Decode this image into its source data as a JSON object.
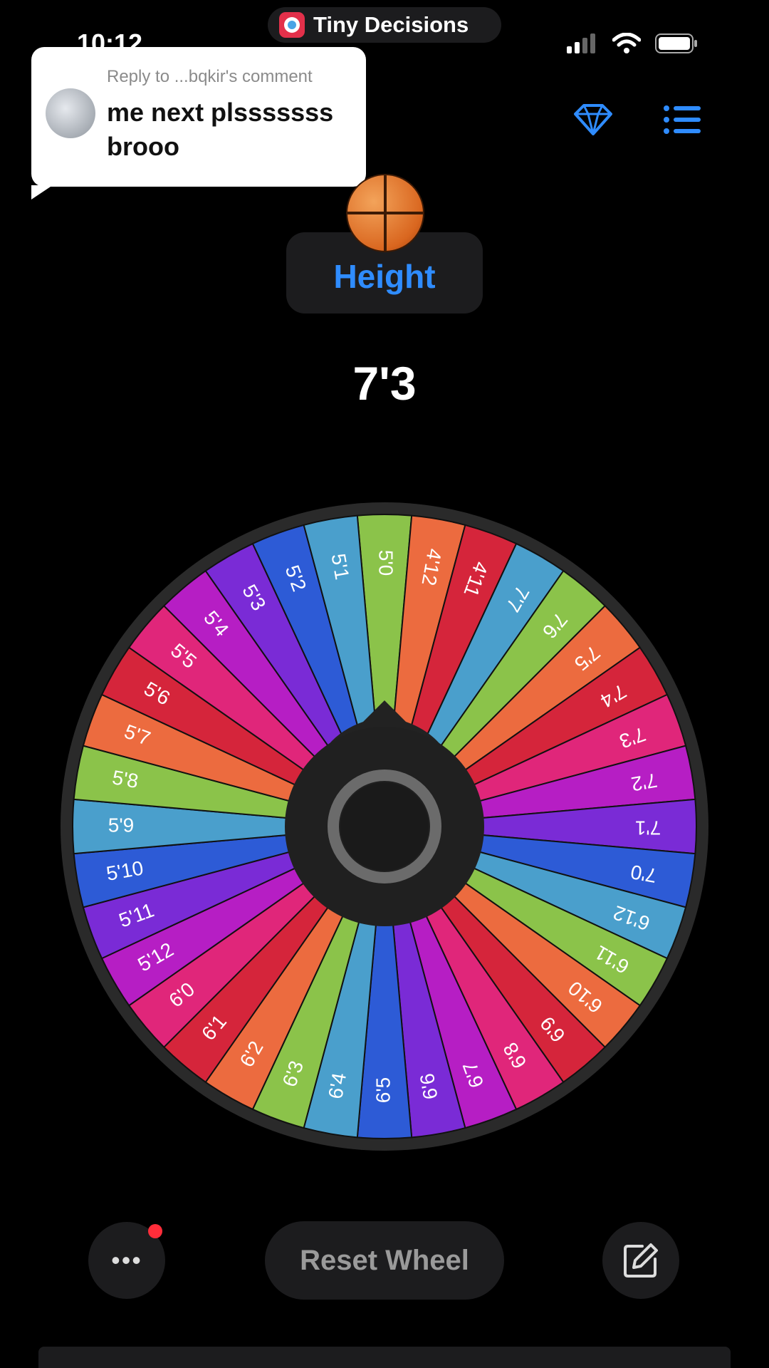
{
  "status_bar": {
    "time": "10:12"
  },
  "overlay_app": {
    "name": "Tiny Decisions"
  },
  "reply": {
    "header": "Reply to ...bqkir's comment",
    "text": "me next plsssssss brooo"
  },
  "wheel_title": {
    "emoji": "basketball",
    "label": "Height"
  },
  "result": "7'3",
  "wheel": {
    "segments": [
      {
        "label": "5'0",
        "color": "#8bc34a"
      },
      {
        "label": "4'12",
        "color": "#ec6b3f"
      },
      {
        "label": "4'11",
        "color": "#d5253b"
      },
      {
        "label": "7'7",
        "color": "#4a9fcc"
      },
      {
        "label": "7'6",
        "color": "#8bc34a"
      },
      {
        "label": "7'5",
        "color": "#ec6b3f"
      },
      {
        "label": "7'4",
        "color": "#d5253b"
      },
      {
        "label": "7'3",
        "color": "#e0267a"
      },
      {
        "label": "7'2",
        "color": "#b61ec4"
      },
      {
        "label": "7'1",
        "color": "#7a2bd6"
      },
      {
        "label": "7'0",
        "color": "#2d5bd6"
      },
      {
        "label": "6'12",
        "color": "#4a9fcc"
      },
      {
        "label": "6'11",
        "color": "#8bc34a"
      },
      {
        "label": "6'10",
        "color": "#ec6b3f"
      },
      {
        "label": "6'9",
        "color": "#d5253b"
      },
      {
        "label": "6'8",
        "color": "#e0267a"
      },
      {
        "label": "6'7",
        "color": "#b61ec4"
      },
      {
        "label": "6'6",
        "color": "#7a2bd6"
      },
      {
        "label": "6'5",
        "color": "#2d5bd6"
      },
      {
        "label": "6'4",
        "color": "#4a9fcc"
      },
      {
        "label": "6'3",
        "color": "#8bc34a"
      },
      {
        "label": "6'2",
        "color": "#ec6b3f"
      },
      {
        "label": "6'1",
        "color": "#d5253b"
      },
      {
        "label": "6'0",
        "color": "#e0267a"
      },
      {
        "label": "5'12",
        "color": "#b61ec4"
      },
      {
        "label": "5'11",
        "color": "#7a2bd6"
      },
      {
        "label": "5'10",
        "color": "#2d5bd6"
      },
      {
        "label": "5'9",
        "color": "#4a9fcc"
      },
      {
        "label": "5'8",
        "color": "#8bc34a"
      },
      {
        "label": "5'7",
        "color": "#ec6b3f"
      },
      {
        "label": "5'6",
        "color": "#d5253b"
      },
      {
        "label": "5'5",
        "color": "#e0267a"
      },
      {
        "label": "5'4",
        "color": "#b61ec4"
      },
      {
        "label": "5'3",
        "color": "#7a2bd6"
      },
      {
        "label": "5'2",
        "color": "#2d5bd6"
      },
      {
        "label": "5'1",
        "color": "#4a9fcc"
      }
    ],
    "pointer_icon": "knob-pointer-icon"
  },
  "controls": {
    "reset_label": "Reset Wheel",
    "menu_icon": "more-dots-icon",
    "edit_icon": "edit-icon"
  },
  "colors": {
    "accent": "#2f8cff",
    "notification": "#ff2d3a"
  }
}
